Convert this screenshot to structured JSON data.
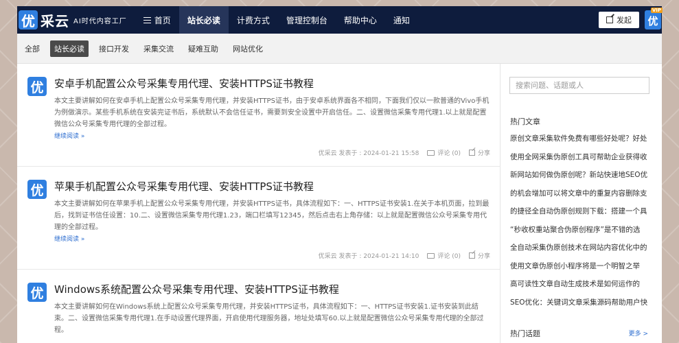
{
  "header": {
    "logo_badge": "优",
    "logo_text": "采云",
    "slogan": "AI时代内容工厂",
    "nav": [
      {
        "label": "首页",
        "icon": "menu-icon"
      },
      {
        "label": "站长必读"
      },
      {
        "label": "计费方式"
      },
      {
        "label": "管理控制台"
      },
      {
        "label": "帮助中心"
      },
      {
        "label": "通知"
      }
    ],
    "post_button": "发起",
    "vip_badge": "VIP",
    "avatar_letter": "优"
  },
  "subnav": [
    "全部",
    "站长必读",
    "接口开发",
    "采集交流",
    "疑难互助",
    "网站优化"
  ],
  "articles": [
    {
      "badge": "优",
      "title": "安卓手机配置公众号采集专用代理、安装HTTPS证书教程",
      "summary": "本文主要讲解如何在安卓手机上配置公众号采集专用代理，并安装HTTPS证书，由于安卓系统界面各不相同，下面我们仅以一款普通的Vivo手机为例做演示。某些手机系统在安装完证书后，系统默认不会信任证书，需要到安全设置中开启信任。二、设置微信采集专用代理1.以上就是配置微信公众号采集专用代理的全部过程。",
      "more": "继续阅读 »",
      "meta": "优采云 发表于 : 2024-01-21 15:58",
      "comment": "评论 (0)",
      "share": "分享"
    },
    {
      "badge": "优",
      "title": "苹果手机配置公众号采集专用代理、安装HTTPS证书教程",
      "summary": "本文主要讲解如何在苹果手机上配置公众号采集专用代理，并安装HTTPS证书，具体流程如下：一、HTTPS证书安装1.在关于本机页面，拉到最后，找到证书信任设置：10.二、设置微信采集专用代理1.23，端口栏填写12345，然后点击右上角存储：以上就是配置微信公众号采集专用代理的全部过程。",
      "more": "继续阅读 »",
      "meta": "优采云 发表于 : 2024-01-21 14:10",
      "comment": "评论 (0)",
      "share": "分享"
    },
    {
      "badge": "优",
      "title": "Windows系统配置公众号采集专用代理、安装HTTPS证书教程",
      "summary": "本文主要讲解如何在Windows系统上配置公众号采集专用代理，并安装HTTPS证书，具体流程如下：一、HTTPS证书安装1.证书安装到此结束。二、设置微信采集专用代理1.在手动设置代理界面，开启使用代理服务器，地址处填写60.以上就是配置微信公众号采集专用代理的全部过程。",
      "more": "",
      "meta": "",
      "comment": "",
      "share": ""
    }
  ],
  "sidebar": {
    "search_placeholder": "搜索问题、话题或人",
    "hot_title": "热门文章",
    "hot_items": [
      "原创文章采集软件免费有哪些好处呢？好处",
      "使用全网采集伪原创工具可帮助企业获得收",
      "新网站如何做伪原创呢？新站快速地SEO优",
      "的机会增加可以将文章中的重复内容删除支",
      "的捷径全自动伪原创规则下载：搭建一个具",
      "“秒收权重站聚合伪原创程序”是不错的选",
      "全自动采集伪原创技术在网站内容优化中的",
      "使用文章伪原创小程序将是一个明智之举",
      "高可读性文章自动生成技术是如何运作的",
      "SEO优化：关键词文章采集源码帮助用户快"
    ],
    "topic_title": "热门话题",
    "topic_more": "更多 >"
  }
}
